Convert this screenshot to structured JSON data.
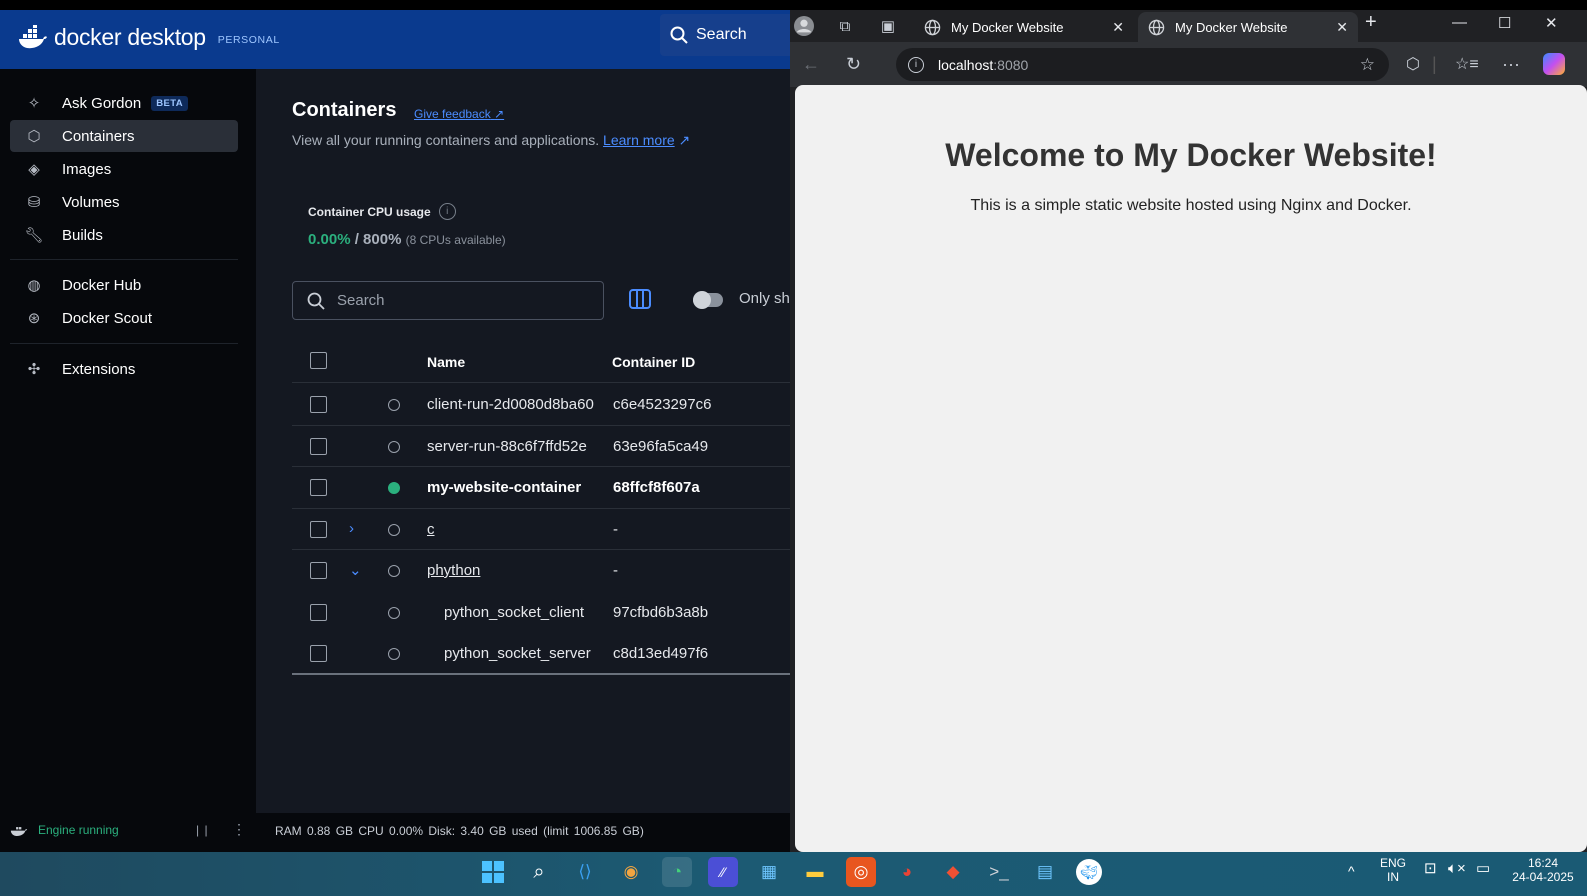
{
  "docker": {
    "brand": "docker desktop",
    "tier": "PERSONAL",
    "search_label": "Search",
    "sidebar": {
      "items": [
        {
          "label": "Ask Gordon",
          "badge": "BETA",
          "icon": "sparkle-icon"
        },
        {
          "label": "Containers",
          "icon": "container-icon",
          "active": true
        },
        {
          "label": "Images",
          "icon": "image-layers-icon"
        },
        {
          "label": "Volumes",
          "icon": "volume-icon"
        },
        {
          "label": "Builds",
          "icon": "wrench-icon"
        },
        {
          "label": "Docker Hub",
          "icon": "globe-icon"
        },
        {
          "label": "Docker Scout",
          "icon": "scout-icon"
        },
        {
          "label": "Extensions",
          "icon": "puzzle-icon"
        }
      ]
    },
    "main": {
      "title": "Containers",
      "feedback": "Give feedback",
      "subtitle": "View all your running containers and applications.",
      "learn_more": "Learn more",
      "cpu_label": "Container CPU usage",
      "cpu_used": "0.00%",
      "cpu_limit": "/ 800%",
      "cpu_avail": "(8 CPUs available)",
      "search_placeholder": "Search",
      "only_show": "Only sh",
      "columns": {
        "name": "Name",
        "id": "Container ID"
      },
      "rows": [
        {
          "name": "client-run-2d0080d8ba60",
          "id": "c6e4523297c6",
          "status": "stopped"
        },
        {
          "name": "server-run-88c6f7ffd52e",
          "id": "63e96fa5ca49",
          "status": "stopped"
        },
        {
          "name": "my-website-container",
          "id": "68ffcf8f607a",
          "status": "running"
        },
        {
          "name": "c",
          "id": "-",
          "status": "stopped",
          "group": "collapsed"
        },
        {
          "name": "phython",
          "id": "-",
          "status": "stopped",
          "group": "expanded"
        },
        {
          "name": "python_socket_client",
          "id": "97cfbd6b3a8b",
          "status": "stopped",
          "child": true
        },
        {
          "name": "python_socket_server",
          "id": "c8d13ed497f6",
          "status": "stopped",
          "child": true
        }
      ]
    },
    "footer": {
      "engine": "Engine running",
      "stats": "RAM 0.88 GB  CPU 0.00%   Disk: 3.40 GB used (limit 1006.85 GB)"
    },
    "colors": {
      "accent": "#4b8cff",
      "running": "#2bb07e",
      "topbar": "#0a3a8e"
    }
  },
  "browser": {
    "tabs": [
      {
        "title": "My Docker Website"
      },
      {
        "title": "My Docker Website",
        "active": true
      }
    ],
    "url_host": "localhost",
    "url_port": ":8080",
    "page": {
      "heading": "Welcome to My Docker Website!",
      "text": "This is a simple static website hosted using Nginx and Docker."
    }
  },
  "taskbar": {
    "lang_top": "ENG",
    "lang_bottom": "IN",
    "time": "16:24",
    "date": "24-04-2025"
  }
}
